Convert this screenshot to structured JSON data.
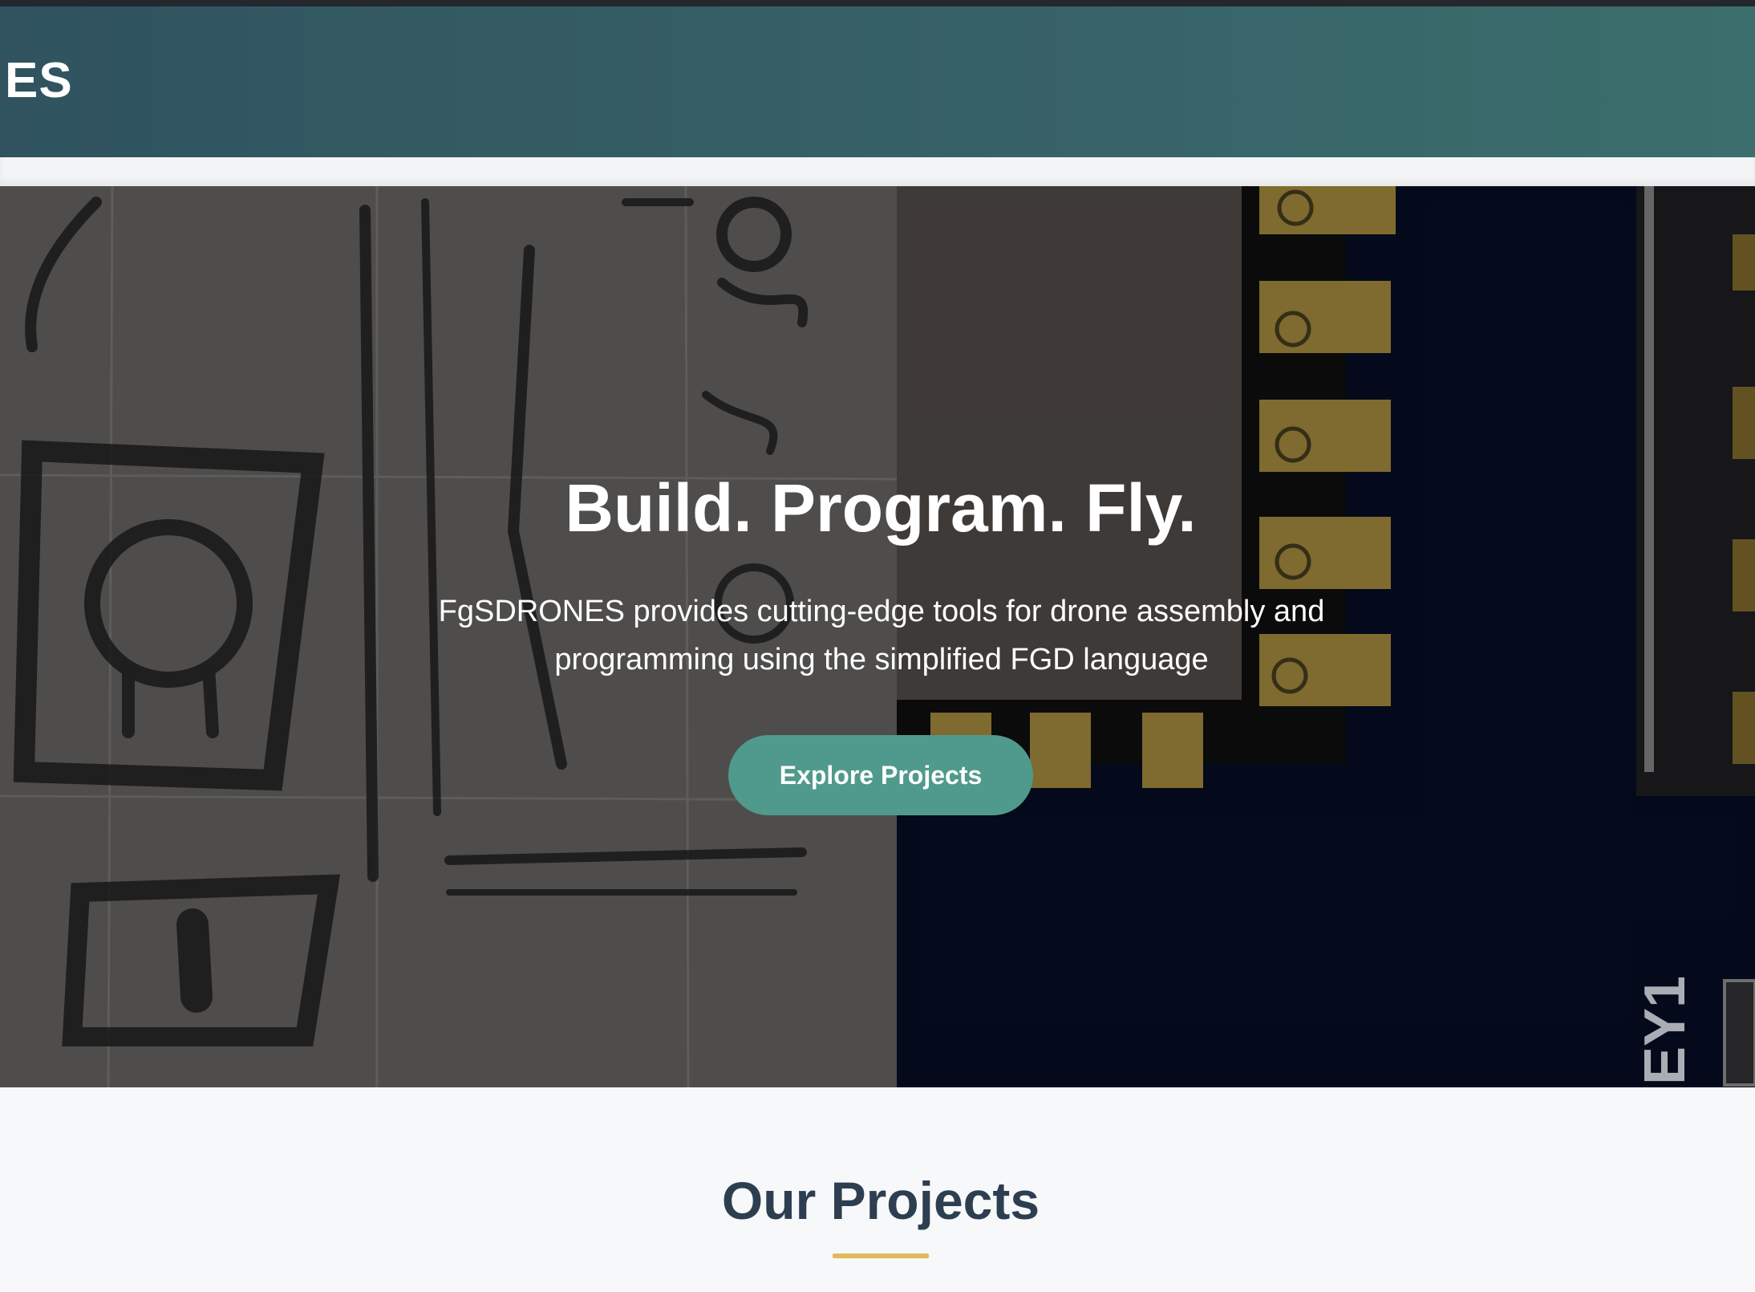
{
  "header": {
    "brand_text": "ES"
  },
  "hero": {
    "title": "Build. Program. Fly.",
    "subtitle": "FgSDRONES provides cutting-edge tools for drone assembly and programming using the simplified FGD language",
    "cta_label": "Explore Projects",
    "pcb_silkscreen": "EY1"
  },
  "projects": {
    "title": "Our Projects"
  },
  "colors": {
    "header": "#376168",
    "button": "#4f9a8c",
    "accent_underline": "#e1b95a",
    "heading": "#2d3e50",
    "pcb_blue": "#050b1f",
    "pad_gold": "#8a7434"
  }
}
